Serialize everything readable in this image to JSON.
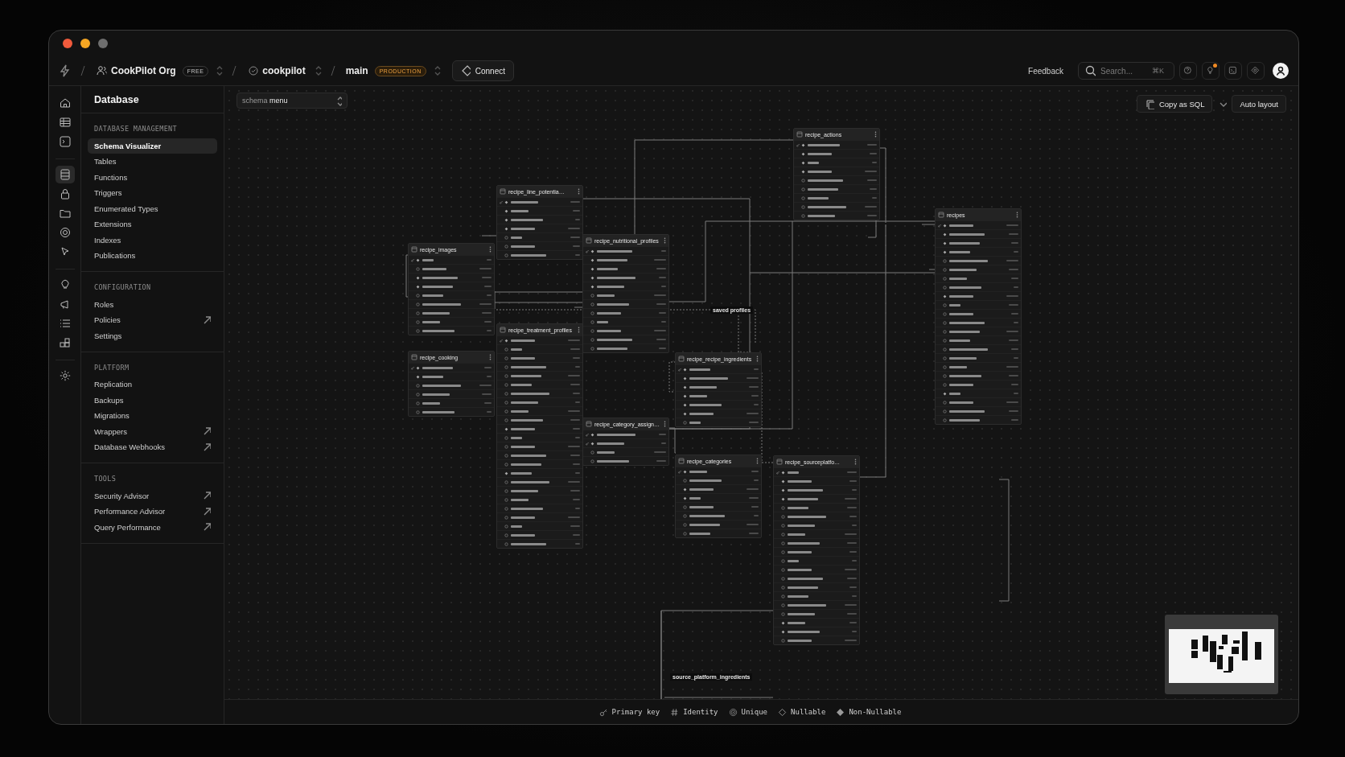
{
  "breadcrumb": {
    "org": "CookPilot Org",
    "plan": "FREE",
    "project": "cookpilot",
    "branch": "main",
    "environment": "PRODUCTION",
    "connect": "Connect"
  },
  "header_right": {
    "feedback": "Feedback",
    "search_placeholder": "Search...",
    "shortcut": "⌘K",
    "notification": true
  },
  "rail": [
    {
      "selected": false
    },
    {
      "selected": false
    },
    {
      "selected": false
    },
    {
      "selected": true
    },
    {
      "selected": false
    },
    {
      "selected": false
    },
    {
      "selected": false
    },
    {
      "selected": false
    },
    {
      "selected": false
    },
    {
      "selected": false
    },
    {
      "selected": false
    },
    {
      "selected": false
    },
    {
      "selected": false
    }
  ],
  "sidebar": {
    "title": "Database",
    "sections": [
      {
        "heading": "DATABASE MANAGEMENT",
        "items": [
          {
            "label": "Schema Visualizer",
            "selected": true,
            "external": false
          },
          {
            "label": "Tables",
            "selected": false,
            "external": false
          },
          {
            "label": "Functions",
            "selected": false,
            "external": false
          },
          {
            "label": "Triggers",
            "selected": false,
            "external": false
          },
          {
            "label": "Enumerated Types",
            "selected": false,
            "external": false
          },
          {
            "label": "Extensions",
            "selected": false,
            "external": false
          },
          {
            "label": "Indexes",
            "selected": false,
            "external": false
          },
          {
            "label": "Publications",
            "selected": false,
            "external": false
          }
        ]
      },
      {
        "heading": "CONFIGURATION",
        "items": [
          {
            "label": "Roles",
            "selected": false,
            "external": false
          },
          {
            "label": "Policies",
            "selected": false,
            "external": true
          },
          {
            "label": "Settings",
            "selected": false,
            "external": false
          }
        ]
      },
      {
        "heading": "PLATFORM",
        "items": [
          {
            "label": "Replication",
            "selected": false,
            "external": false
          },
          {
            "label": "Backups",
            "selected": false,
            "external": false
          },
          {
            "label": "Migrations",
            "selected": false,
            "external": false
          },
          {
            "label": "Wrappers",
            "selected": false,
            "external": true
          },
          {
            "label": "Database Webhooks",
            "selected": false,
            "external": true
          }
        ]
      },
      {
        "heading": "TOOLS",
        "items": [
          {
            "label": "Security Advisor",
            "selected": false,
            "external": true
          },
          {
            "label": "Performance Advisor",
            "selected": false,
            "external": true
          },
          {
            "label": "Query Performance",
            "selected": false,
            "external": true
          }
        ]
      }
    ]
  },
  "toolbar": {
    "schema_label": "schema",
    "schema_value": "menu",
    "copy_sql": "Copy as SQL",
    "auto_layout": "Auto layout"
  },
  "tables": [
    {
      "name": "recipe_images",
      "columns": [
        {
          "primary": true,
          "nullable": false
        },
        {
          "primary": false,
          "nullable": true
        },
        {
          "primary": false,
          "nullable": false
        },
        {
          "primary": false,
          "nullable": false
        },
        {
          "primary": false,
          "nullable": true
        },
        {
          "primary": false,
          "nullable": true
        },
        {
          "primary": false,
          "nullable": true
        },
        {
          "primary": false,
          "nullable": true
        },
        {
          "primary": false,
          "nullable": true
        }
      ]
    },
    {
      "name": "recipe_cooking",
      "columns": [
        {
          "primary": true,
          "nullable": false
        },
        {
          "primary": false,
          "nullable": false
        },
        {
          "primary": false,
          "nullable": true
        },
        {
          "primary": false,
          "nullable": true
        },
        {
          "primary": false,
          "nullable": true
        },
        {
          "primary": false,
          "nullable": true
        }
      ]
    },
    {
      "name": "recipe_line_potentia…",
      "columns": [
        {
          "primary": true,
          "nullable": false
        },
        {
          "primary": false,
          "nullable": false
        },
        {
          "primary": false,
          "nullable": false
        },
        {
          "primary": false,
          "nullable": false
        },
        {
          "primary": false,
          "nullable": true
        },
        {
          "primary": false,
          "nullable": true
        },
        {
          "primary": false,
          "nullable": true
        }
      ]
    },
    {
      "name": "recipe_treatment_profiles",
      "columns": [
        {
          "primary": true,
          "nullable": false
        },
        {
          "primary": false,
          "nullable": true
        },
        {
          "primary": false,
          "nullable": true
        },
        {
          "primary": false,
          "nullable": true
        },
        {
          "primary": false,
          "nullable": true
        },
        {
          "primary": false,
          "nullable": true
        },
        {
          "primary": false,
          "nullable": true
        },
        {
          "primary": false,
          "nullable": true
        },
        {
          "primary": false,
          "nullable": true
        },
        {
          "primary": false,
          "nullable": true
        },
        {
          "primary": false,
          "nullable": false
        },
        {
          "primary": false,
          "nullable": true
        },
        {
          "primary": false,
          "nullable": true
        },
        {
          "primary": false,
          "nullable": true
        },
        {
          "primary": false,
          "nullable": true
        },
        {
          "primary": false,
          "nullable": false
        },
        {
          "primary": false,
          "nullable": true
        },
        {
          "primary": false,
          "nullable": true
        },
        {
          "primary": false,
          "nullable": true
        },
        {
          "primary": false,
          "nullable": true
        },
        {
          "primary": false,
          "nullable": true
        },
        {
          "primary": false,
          "nullable": true
        },
        {
          "primary": false,
          "nullable": true
        },
        {
          "primary": false,
          "nullable": true
        }
      ]
    },
    {
      "name": "recipe_nutritional_profiles",
      "columns": [
        {
          "primary": true,
          "nullable": false
        },
        {
          "primary": false,
          "nullable": false
        },
        {
          "primary": false,
          "nullable": false
        },
        {
          "primary": false,
          "nullable": false
        },
        {
          "primary": false,
          "nullable": false
        },
        {
          "primary": false,
          "nullable": true
        },
        {
          "primary": false,
          "nullable": true
        },
        {
          "primary": false,
          "nullable": true
        },
        {
          "primary": false,
          "nullable": true
        },
        {
          "primary": false,
          "nullable": true
        },
        {
          "primary": false,
          "nullable": true
        },
        {
          "primary": false,
          "nullable": true
        }
      ]
    },
    {
      "name": "recipe_category_assign…",
      "columns": [
        {
          "primary": true,
          "nullable": false
        },
        {
          "primary": true,
          "nullable": false
        },
        {
          "primary": false,
          "nullable": true
        },
        {
          "primary": false,
          "nullable": true
        }
      ]
    },
    {
      "name": "recipe_actions",
      "columns": [
        {
          "primary": true,
          "nullable": false
        },
        {
          "primary": false,
          "nullable": false
        },
        {
          "primary": false,
          "nullable": false
        },
        {
          "primary": false,
          "nullable": false
        },
        {
          "primary": false,
          "nullable": true
        },
        {
          "primary": false,
          "nullable": true
        },
        {
          "primary": false,
          "nullable": true
        },
        {
          "primary": false,
          "nullable": true
        },
        {
          "primary": false,
          "nullable": true
        }
      ]
    },
    {
      "name": "recipes",
      "columns": [
        {
          "primary": true,
          "nullable": false
        },
        {
          "primary": false,
          "nullable": false
        },
        {
          "primary": false,
          "nullable": false
        },
        {
          "primary": false,
          "nullable": false
        },
        {
          "primary": false,
          "nullable": true
        },
        {
          "primary": false,
          "nullable": true
        },
        {
          "primary": false,
          "nullable": true
        },
        {
          "primary": false,
          "nullable": true
        },
        {
          "primary": false,
          "nullable": false
        },
        {
          "primary": false,
          "nullable": true
        },
        {
          "primary": false,
          "nullable": true
        },
        {
          "primary": false,
          "nullable": true
        },
        {
          "primary": false,
          "nullable": true
        },
        {
          "primary": false,
          "nullable": true
        },
        {
          "primary": false,
          "nullable": true
        },
        {
          "primary": false,
          "nullable": true
        },
        {
          "primary": false,
          "nullable": true
        },
        {
          "primary": false,
          "nullable": true
        },
        {
          "primary": false,
          "nullable": true
        },
        {
          "primary": false,
          "nullable": false
        },
        {
          "primary": false,
          "nullable": true
        },
        {
          "primary": false,
          "nullable": true
        },
        {
          "primary": false,
          "nullable": true
        }
      ]
    },
    {
      "name": "recipe_recipe_ingredients",
      "columns": [
        {
          "primary": true,
          "nullable": false
        },
        {
          "primary": false,
          "nullable": false
        },
        {
          "primary": false,
          "nullable": false
        },
        {
          "primary": false,
          "nullable": false
        },
        {
          "primary": false,
          "nullable": false
        },
        {
          "primary": false,
          "nullable": false
        },
        {
          "primary": false,
          "nullable": true
        }
      ]
    },
    {
      "name": "recipe_categories",
      "columns": [
        {
          "primary": true,
          "nullable": false
        },
        {
          "primary": false,
          "nullable": true
        },
        {
          "primary": false,
          "nullable": false
        },
        {
          "primary": false,
          "nullable": false
        },
        {
          "primary": false,
          "nullable": true
        },
        {
          "primary": false,
          "nullable": true
        },
        {
          "primary": false,
          "nullable": true
        },
        {
          "primary": false,
          "nullable": true
        }
      ]
    },
    {
      "name": "recipe_sourceplatfo…",
      "columns": [
        {
          "primary": true,
          "nullable": false
        },
        {
          "primary": false,
          "nullable": false
        },
        {
          "primary": false,
          "nullable": false
        },
        {
          "primary": false,
          "nullable": false
        },
        {
          "primary": false,
          "nullable": true
        },
        {
          "primary": false,
          "nullable": true
        },
        {
          "primary": false,
          "nullable": true
        },
        {
          "primary": false,
          "nullable": true
        },
        {
          "primary": false,
          "nullable": true
        },
        {
          "primary": false,
          "nullable": true
        },
        {
          "primary": false,
          "nullable": true
        },
        {
          "primary": false,
          "nullable": true
        },
        {
          "primary": false,
          "nullable": true
        },
        {
          "primary": false,
          "nullable": true
        },
        {
          "primary": false,
          "nullable": true
        },
        {
          "primary": false,
          "nullable": true
        },
        {
          "primary": false,
          "nullable": true
        },
        {
          "primary": false,
          "nullable": false
        },
        {
          "primary": false,
          "nullable": false
        },
        {
          "primary": false,
          "nullable": true
        }
      ]
    }
  ],
  "edge_labels": [
    "saved profiles",
    "source_platform_ingredients"
  ],
  "legend": [
    {
      "kind": "primary",
      "label": "Primary key"
    },
    {
      "kind": "identity",
      "label": "Identity"
    },
    {
      "kind": "unique",
      "label": "Unique"
    },
    {
      "kind": "nullable",
      "label": "Nullable"
    },
    {
      "kind": "nonnullable",
      "label": "Non-Nullable"
    }
  ]
}
